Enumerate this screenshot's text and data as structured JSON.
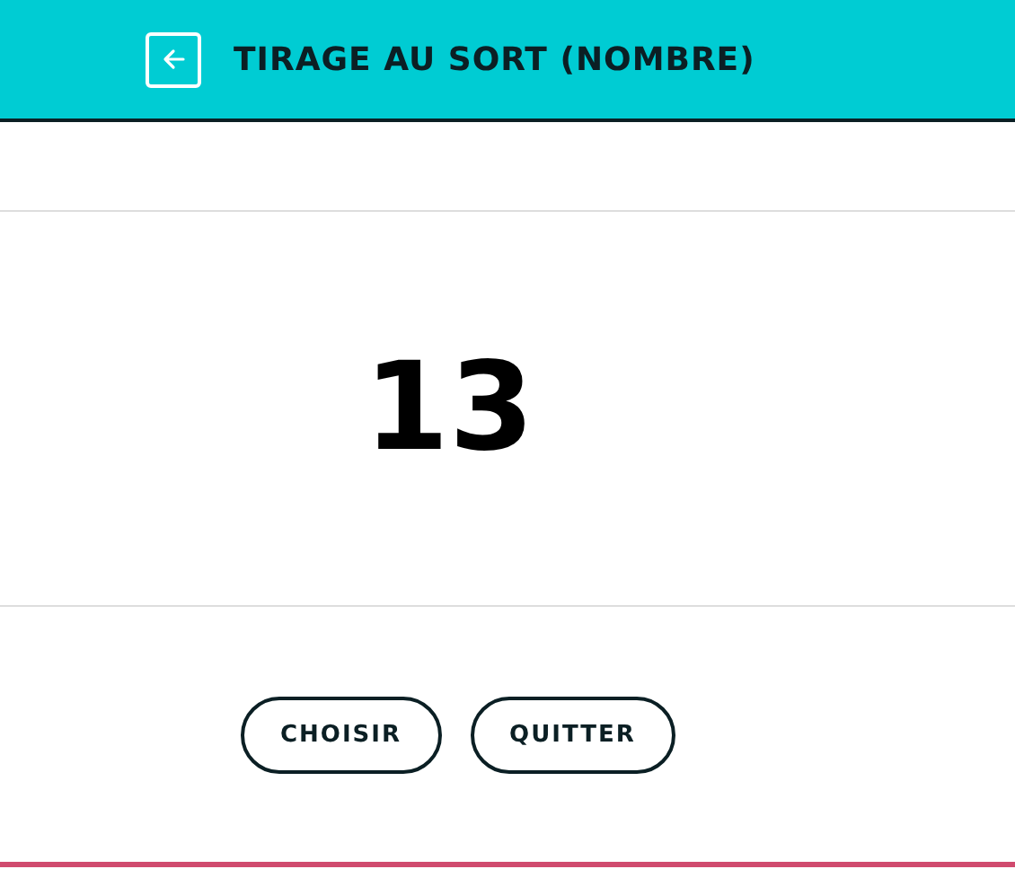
{
  "header": {
    "title": "TIRAGE AU SORT (NOMBRE)"
  },
  "result": "13",
  "buttons": [
    "CHOISIR",
    "QUITTER"
  ]
}
